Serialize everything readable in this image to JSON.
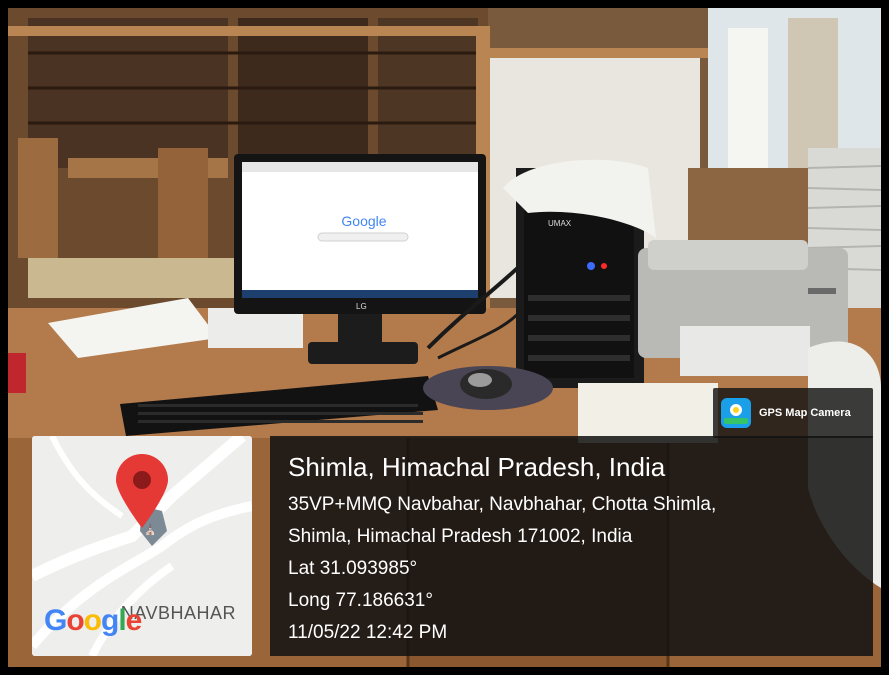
{
  "camera_badge": {
    "label": "GPS Map Camera",
    "icon": "gps-map-camera-icon"
  },
  "location": {
    "title": "Shimla, Himachal Pradesh, India",
    "address_line1": "35VP+MMQ Navbahar, Navbhahar, Chotta Shimla,",
    "address_line2": "Shimla, Himachal Pradesh 171002, India",
    "latitude": "Lat 31.093985°",
    "longitude": "Long 77.186631°",
    "datetime": "11/05/22 12:42 PM"
  },
  "map": {
    "area_label": "NAVBHAHAR",
    "logo_text": "Google",
    "pin_color": "#e53935"
  },
  "screen": {
    "search_brand": "Google",
    "monitor_brand": "LG"
  },
  "pc_case": {
    "brand": "UMAX"
  },
  "colors": {
    "overlay_bg": "#121212",
    "text": "#ffffff",
    "pin": "#e53935"
  }
}
